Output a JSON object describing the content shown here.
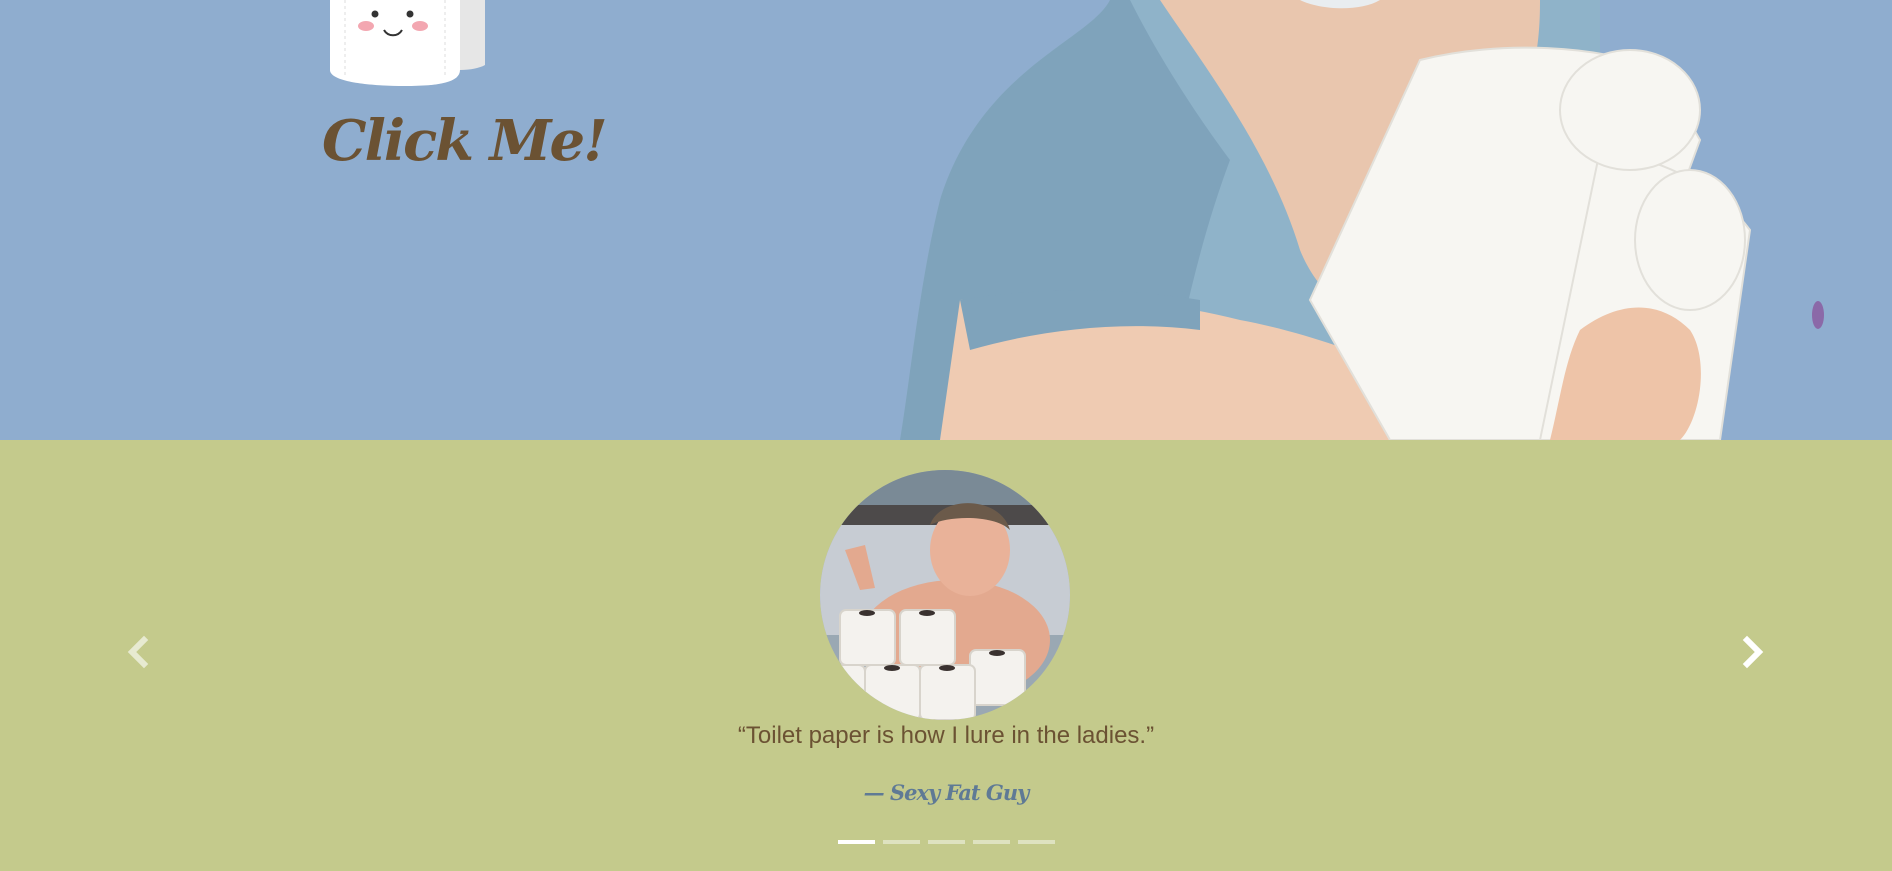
{
  "hero": {
    "cta_label": "Click Me!",
    "background_color": "#8fadcf",
    "illustration": "toilet-paper-roll-mascot",
    "photo": "woman-holding-toilet-paper"
  },
  "testimonials": {
    "background_color": "#c4ca8c",
    "photo": "man-in-bed-with-toilet-paper",
    "quote": "“Toilet paper is how I lure in the ladies.”",
    "author": "— Sexy Fat Guy",
    "prev_icon": "chevron-left-icon",
    "next_icon": "chevron-right-icon",
    "active_slide": 1,
    "slide_count": 5
  }
}
